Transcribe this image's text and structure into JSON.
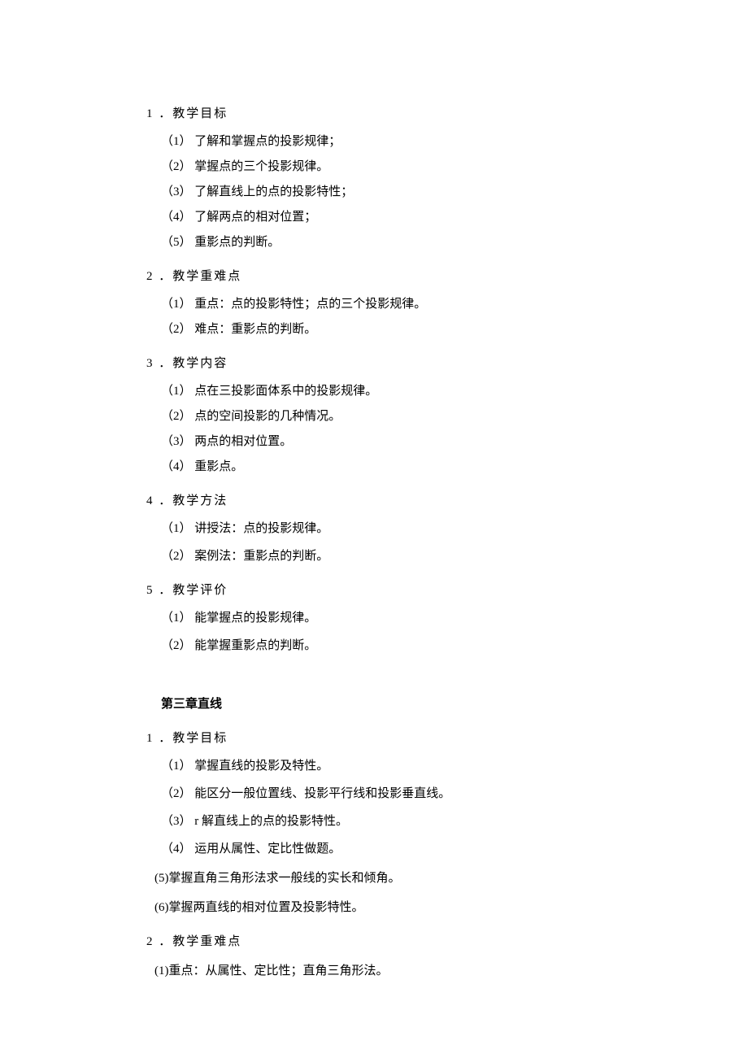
{
  "sections": [
    {
      "heading": "1 ．教学目标",
      "items": [
        {
          "text": "（1） 了解和掌握点的投影规律；",
          "cls": "sub-item-tight"
        },
        {
          "text": "（2） 掌握点的三个投影规律。",
          "cls": "sub-item-tight"
        },
        {
          "text": "（3） 了解直线上的点的投影特性；",
          "cls": "sub-item-tight"
        },
        {
          "text": "（4） 了解两点的相对位置；",
          "cls": "sub-item-tight"
        },
        {
          "text": "（5） 重影点的判断。",
          "cls": "sub-item-tight"
        }
      ]
    },
    {
      "heading": "2 ．教学重难点",
      "items": [
        {
          "text": "（1） 重点：点的投影特性；点的三个投影规律。",
          "cls": "sub-item-tight"
        },
        {
          "text": "（2） 难点：重影点的判断。",
          "cls": "sub-item-tight"
        }
      ]
    },
    {
      "heading": "3 ．教学内容",
      "items": [
        {
          "text": "（1） 点在三投影面体系中的投影规律。",
          "cls": "sub-item-tight"
        },
        {
          "text": "（2） 点的空间投影的几种情况。",
          "cls": "sub-item-tight"
        },
        {
          "text": "（3） 两点的相对位置。",
          "cls": "sub-item-tight"
        },
        {
          "text": "（4） 重影点。",
          "cls": "sub-item-tight"
        }
      ]
    },
    {
      "heading": "4 ．教学方法",
      "items": [
        {
          "text": "（1） 讲授法：点的投影规律。",
          "cls": "sub-item"
        },
        {
          "text": "（2） 案例法：重影点的判断。",
          "cls": "sub-item"
        }
      ]
    },
    {
      "heading": "5 ．教学评价",
      "items": [
        {
          "text": "（1） 能掌握点的投影规律。",
          "cls": "sub-item"
        },
        {
          "text": "（2） 能掌握重影点的判断。",
          "cls": "sub-item"
        }
      ]
    }
  ],
  "chapter": {
    "title": "第三章直线"
  },
  "ch3sections": [
    {
      "heading": "1 ．教学目标",
      "items": [
        {
          "text": "（1） 掌握直线的投影及特性。",
          "cls": "sub-item"
        },
        {
          "text": "（2） 能区分一般位置线、投影平行线和投影垂直线。",
          "cls": "sub-item"
        },
        {
          "text": "（3） r 解直线上的点的投影特性。",
          "cls": "sub-item"
        },
        {
          "text": "（4） 运用从属性、定比性做题。",
          "cls": "sub-item"
        },
        {
          "text": "(5)掌握直角三角形法求一般线的实长和倾角。",
          "cls": "sub-item-left"
        },
        {
          "text": "(6)掌握两直线的相对位置及投影特性。",
          "cls": "sub-item-left"
        }
      ]
    },
    {
      "heading": "2 ．教学重难点",
      "items": [
        {
          "text": "(1)重点：从属性、定比性；直角三角形法。",
          "cls": "sub-item-left"
        }
      ]
    }
  ]
}
